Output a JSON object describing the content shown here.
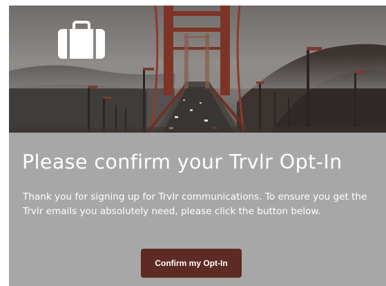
{
  "hero": {
    "icon": "briefcase-icon",
    "image_subject": "bridge-photo"
  },
  "content": {
    "headline": "Please confirm your Trvlr Opt-In",
    "body": "Thank you for signing up for Trvlr communications. To ensure you get the Trvlr emails you absolutely need, please click the button below.",
    "button_label": "Confirm my Opt-In"
  },
  "colors": {
    "card_background": "#a7a7a7",
    "button_background": "#5d2a24",
    "text": "#ffffff"
  }
}
